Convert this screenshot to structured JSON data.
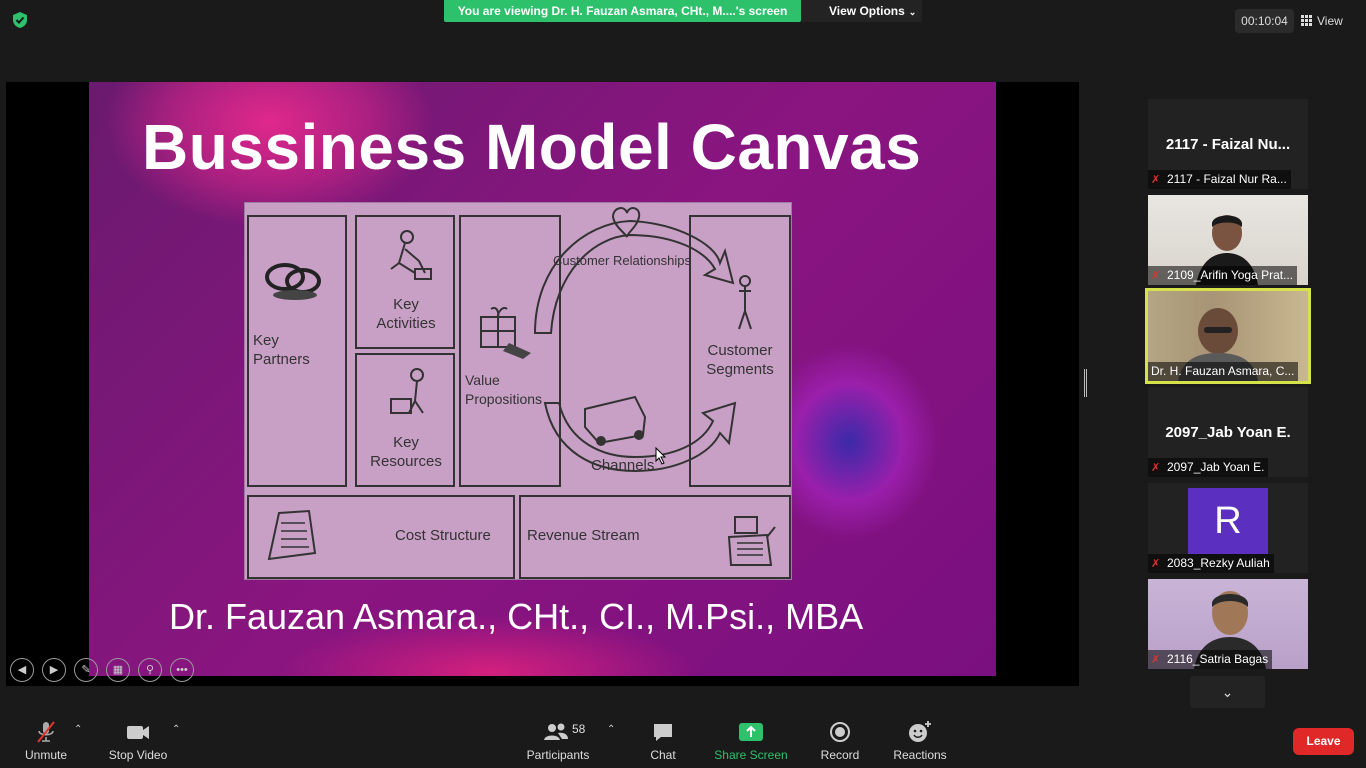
{
  "top": {
    "banner": "You are viewing Dr. H. Fauzan Asmara, CHt., M....'s screen",
    "view_options": "View Options",
    "timer": "00:10:04",
    "view": "View"
  },
  "slide": {
    "title": "Bussiness Model Canvas",
    "author": "Dr. Fauzan Asmara., CHt., CI., M.Psi., MBA",
    "canvas": {
      "key_partners": "Key\nPartners",
      "key_activities": "Key\nActivities",
      "key_resources": "Key\nResources",
      "value_propositions": "Value\nPropositions",
      "customer_relationships": "Customer Relationships",
      "channels": "Channels",
      "customer_segments": "Customer\nSegments",
      "cost_structure": "Cost Structure",
      "revenue_stream": "Revenue Stream"
    }
  },
  "participants_panel": {
    "tiles": [
      {
        "big": "2117 - Faizal Nu...",
        "name": "2117 - Faizal Nur Ra..."
      },
      {
        "name": "2109_Arifin Yoga Prat..."
      },
      {
        "name": "Dr. H. Fauzan Asmara, C..."
      },
      {
        "big": "2097_Jab Yoan E.",
        "name": "2097_Jab Yoan E."
      },
      {
        "avatar_letter": "R",
        "name": "2083_Rezky Auliah"
      },
      {
        "name": "2116_Satria Bagas"
      }
    ]
  },
  "toolbar": {
    "unmute": "Unmute",
    "stop_video": "Stop Video",
    "participants": "Participants",
    "participants_count": "58",
    "chat": "Chat",
    "share_screen": "Share Screen",
    "record": "Record",
    "reactions": "Reactions",
    "leave": "Leave"
  },
  "colors": {
    "banner_green": "#2ec16c",
    "leave_red": "#e02828",
    "active_speaker": "#d6e24a",
    "mute_red": "#e0342c"
  }
}
